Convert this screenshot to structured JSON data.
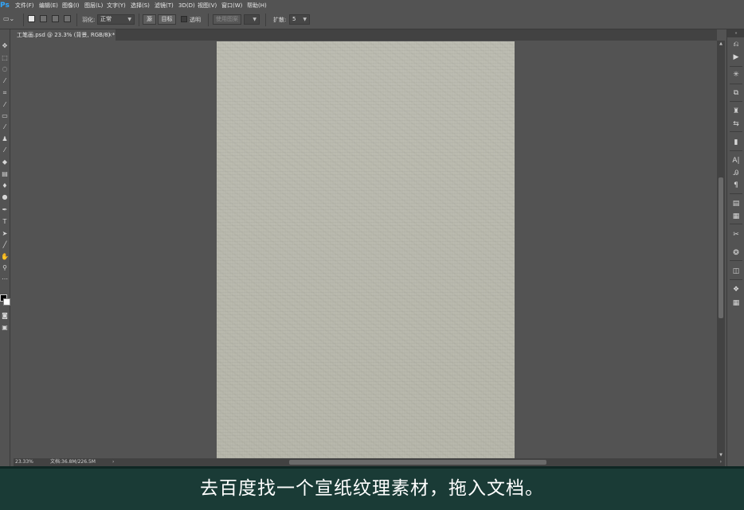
{
  "app": {
    "logo": "Ps"
  },
  "menu": [
    "文件(F)",
    "编辑(E)",
    "图像(I)",
    "图层(L)",
    "文字(Y)",
    "选择(S)",
    "滤镜(T)",
    "3D(D)",
    "视图(V)",
    "窗口(W)",
    "帮助(H)"
  ],
  "options_bar": {
    "feather_label": "羽化:",
    "mode_value": "正常",
    "source_button": "源",
    "target_button": "目标",
    "transparent_label": "透明",
    "use_pattern_button": "使用图案",
    "diffusion_label": "扩散:",
    "diffusion_value": "5"
  },
  "document_tab": {
    "title": "工笔画.psd @ 23.3% (背景, RGB/8) *",
    "close": "×"
  },
  "status_bar": {
    "zoom": "23.33%",
    "doc_info": "文档:36.8M/226.5M"
  },
  "subtitle": "去百度找一个宣纸纹理素材，拖入文档。",
  "colors": {
    "ui_background": "#535353",
    "paper": "#b8b8ad",
    "subtitle_bg": "#1a3b36",
    "ps_accent": "#31a8ff"
  },
  "icons": {
    "toolbox": [
      "move-icon",
      "marquee-icon",
      "lasso-icon",
      "quick-select-icon",
      "crop-icon",
      "eyedropper-icon",
      "patch-icon",
      "brush-icon",
      "stamp-icon",
      "history-brush-icon",
      "eraser-icon",
      "gradient-icon",
      "blur-icon",
      "dodge-icon",
      "pen-icon",
      "type-icon",
      "path-select-icon",
      "line-icon",
      "hand-icon",
      "zoom-icon",
      "more-tools-icon",
      "color-swatch-icon",
      "quick-mask-icon",
      "screen-mode-icon"
    ],
    "dock": [
      "history-icon",
      "actions-icon",
      "color-icon",
      "swatches-icon",
      "brushes-icon",
      "adjustments-icon",
      "layers-icon",
      "character-icon",
      "character-style-icon",
      "paragraph-icon",
      "notes-icon",
      "properties-icon",
      "tools-presets-icon",
      "clone-source-icon",
      "channels-icon",
      "3d-icon",
      "table-icon"
    ]
  }
}
